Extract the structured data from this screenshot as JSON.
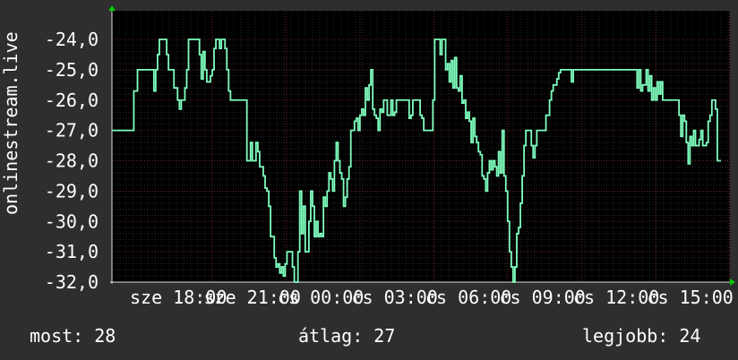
{
  "chart_data": {
    "type": "line",
    "ylabel": "onlinestream.live",
    "ylim": [
      -32,
      -24
    ],
    "yticks": [
      "-24,0",
      "-25,0",
      "-26,0",
      "-27,0",
      "-28,0",
      "-29,0",
      "-30,0",
      "-31,0",
      "-32,0"
    ],
    "xlabels": [
      "sze 18:00",
      "sze 21:00",
      "cs 00:00",
      "cs 03:00",
      "cs 06:00",
      "cs 09:00",
      "cs 12:00",
      "cs 15:00"
    ],
    "grid": true,
    "colors": {
      "background": "#2e2e2e",
      "plot": "#000000",
      "line": "#7fffbf",
      "grid_minor": "#3a3a3a",
      "grid_major": "#7a2a2a",
      "axis": "#00cc00"
    },
    "series": [
      {
        "values": [
          -27,
          -27,
          -27,
          -27,
          -27,
          -27,
          -27,
          -27,
          -27,
          -27,
          -27,
          -27,
          -25.7,
          -25.7,
          -25,
          -25,
          -25,
          -25,
          -25,
          -25,
          -25,
          -25,
          -25,
          -25.7,
          -25,
          -24.5,
          -24,
          -24,
          -24,
          -24,
          -24.5,
          -25,
          -25,
          -25,
          -25.6,
          -25.6,
          -26,
          -26.3,
          -26,
          -26,
          -25.6,
          -25,
          -24,
          -24,
          -24,
          -24,
          -24,
          -24,
          -24.5,
          -25.3,
          -24.4,
          -25,
          -25.4,
          -25.4,
          -25.2,
          -25,
          -24.3,
          -24,
          -24,
          -24.3,
          -24,
          -24,
          -24.3,
          -25,
          -25.7,
          -26,
          -26,
          -26,
          -26,
          -26,
          -26,
          -26,
          -26,
          -26,
          -28,
          -28,
          -27.4,
          -28,
          -28,
          -27.4,
          -27.7,
          -28.2,
          -28.2,
          -28.5,
          -28.9,
          -29,
          -29.5,
          -30.5,
          -30.5,
          -31.2,
          -31.5,
          -31.4,
          -31.7,
          -31.5,
          -31.8,
          -31.4,
          -31,
          -31,
          -31,
          -31.5,
          -32,
          -32,
          -31,
          -29,
          -30.4,
          -29.5,
          -31,
          -31,
          -30,
          -29,
          -29.5,
          -30.5,
          -30,
          -30.5,
          -30.4,
          -30.5,
          -29.2,
          -29.5,
          -29,
          -28.4,
          -28.6,
          -29,
          -28,
          -27.4,
          -28,
          -28.4,
          -28.6,
          -29.5,
          -29.2,
          -28.6,
          -28.2,
          -27,
          -27,
          -26.7,
          -26.6,
          -27,
          -26.5,
          -26.3,
          -26.5,
          -25.6,
          -26,
          -25.5,
          -25,
          -26.3,
          -26.5,
          -26.6,
          -27,
          -26.3,
          -26.4,
          -26,
          -26,
          -26.5,
          -26.5,
          -26,
          -26.5,
          -26.4,
          -26,
          -26,
          -26,
          -26,
          -26,
          -26,
          -26,
          -26.6,
          -26.5,
          -26,
          -26,
          -26,
          -26,
          -26.5,
          -26.6,
          -27,
          -27,
          -27,
          -27,
          -27,
          -26,
          -24,
          -24,
          -24,
          -24.5,
          -24,
          -24,
          -25,
          -24.8,
          -25.4,
          -24.7,
          -25.6,
          -24.6,
          -25.6,
          -25.7,
          -25.2,
          -26.1,
          -26,
          -26.6,
          -26.4,
          -26.7,
          -27.4,
          -26.6,
          -27.2,
          -27.4,
          -27.7,
          -27.8,
          -28.5,
          -28.6,
          -29,
          -28.4,
          -28,
          -28.3,
          -28,
          -28.2,
          -28.5,
          -27.7,
          -28.4,
          -27,
          -28.5,
          -29,
          -30,
          -31,
          -31.5,
          -32,
          -31.5,
          -30.4,
          -30.2,
          -29.4,
          -28.5,
          -27.5,
          -27,
          -27,
          -27,
          -27.5,
          -27.9,
          -27.5,
          -27,
          -27,
          -27,
          -27,
          -27,
          -26.5,
          -26.5,
          -26,
          -25.7,
          -25.5,
          -25.5,
          -25.3,
          -25.1,
          -25,
          -25,
          -25,
          -25,
          -25,
          -25,
          -25.4,
          -25,
          -25,
          -25,
          -25,
          -25,
          -25,
          -25,
          -25,
          -25,
          -25,
          -25,
          -25,
          -25,
          -25,
          -25,
          -25,
          -25,
          -25,
          -25,
          -25,
          -25,
          -25,
          -25,
          -25,
          -25,
          -25,
          -25,
          -25,
          -25,
          -25,
          -25,
          -25,
          -25,
          -25,
          -25,
          -25.6,
          -25,
          -25.7,
          -25.5,
          -25.5,
          -25,
          -25.7,
          -25.2,
          -26,
          -25.6,
          -26,
          -25.4,
          -25.8,
          -25.4,
          -26,
          -26,
          -26,
          -26,
          -26,
          -26,
          -26,
          -26,
          -26,
          -26.5,
          -27.2,
          -26.5,
          -26.7,
          -27.4,
          -28.1,
          -27.2,
          -27.5,
          -27,
          -27.5,
          -27.5,
          -27.3,
          -27,
          -27.5,
          -27.5,
          -27.4,
          -26.7,
          -26.5,
          -26,
          -26,
          -26.3,
          -28,
          -28,
          -28
        ]
      }
    ]
  },
  "footer": {
    "now": "most: 28",
    "avg": "átlag: 27",
    "best": "legjobb: 24"
  }
}
